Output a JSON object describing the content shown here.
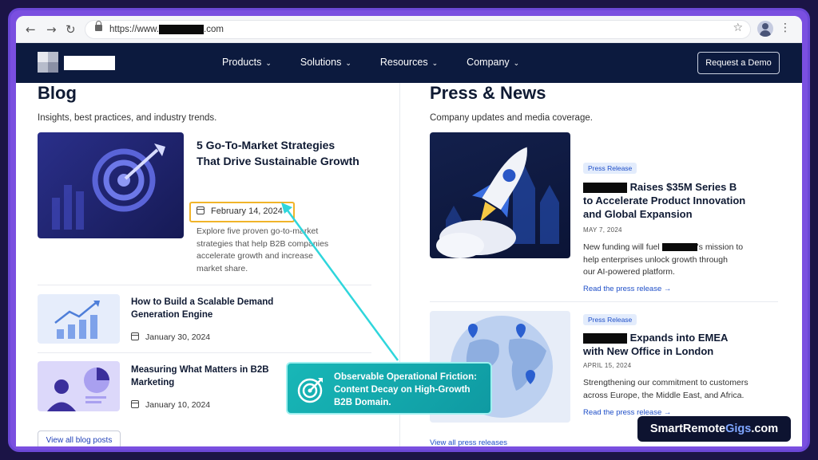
{
  "browser": {
    "url_prefix": "https://www.",
    "url_suffix": ".com"
  },
  "header": {
    "nav": [
      {
        "label": "Products"
      },
      {
        "label": "Solutions"
      },
      {
        "label": "Resources"
      },
      {
        "label": "Company"
      }
    ],
    "cta_label": "Request a Demo"
  },
  "blog": {
    "title": "Blog",
    "subtitle": "Insights, best practices, and industry trends.",
    "featured": {
      "title_line1": "5 Go-To-Market Strategies",
      "title_line2": "That Drive Sustainable Growth",
      "date": "February 14, 2024",
      "excerpt_line1": "Explore five proven go-to-market",
      "excerpt_line2": "strategies that help B2B companies",
      "excerpt_line3": "accelerate growth and increase",
      "excerpt_line4": "market share."
    },
    "posts": [
      {
        "title_line1": "How to Build a Scalable Demand",
        "title_line2": "Generation Engine",
        "date": "January 30, 2024"
      },
      {
        "title_line1": "Measuring What Matters in B2B",
        "title_line2": "Marketing",
        "date": "January 10, 2024"
      }
    ],
    "view_all": "View all blog posts"
  },
  "press": {
    "title": "Press & News",
    "subtitle": "Company updates and media coverage.",
    "items": [
      {
        "badge": "Press Release",
        "title_line1_after_redaction": " Raises $35M Series B",
        "title_line2": "to Accelerate Product Innovation",
        "title_line3": "and Global Expansion",
        "date": "MAY 7, 2024",
        "excerpt_line1_before": "New funding will fuel ",
        "excerpt_line1_after": "'s mission to",
        "excerpt_line2": "help enterprises unlock growth through",
        "excerpt_line3": "our AI-powered platform.",
        "link": "Read the press release →"
      },
      {
        "badge": "Press Release",
        "title_line1_after_redaction": " Expands into EMEA",
        "title_line2": "with New Office in London",
        "date": "APRIL 15, 2024",
        "excerpt_line1": "Strengthening our commitment to customers",
        "excerpt_line2": "across Europe, the Middle East, and Africa.",
        "link": "Read the press release →"
      }
    ],
    "view_all": "View all press releases"
  },
  "callout": {
    "line1": "Observable Operational Friction:",
    "line2": "Content Decay on High-Growth",
    "line3": "B2B Domain."
  },
  "brand": {
    "part1": "SmartRemote",
    "part2": "Gigs",
    "part3": ".com"
  },
  "colors": {
    "nav_bg": "#0c1a3e",
    "frame": "#7a4fe0",
    "highlight": "#f0b429",
    "callout": "#18b7b7",
    "link": "#1f4fc8"
  }
}
